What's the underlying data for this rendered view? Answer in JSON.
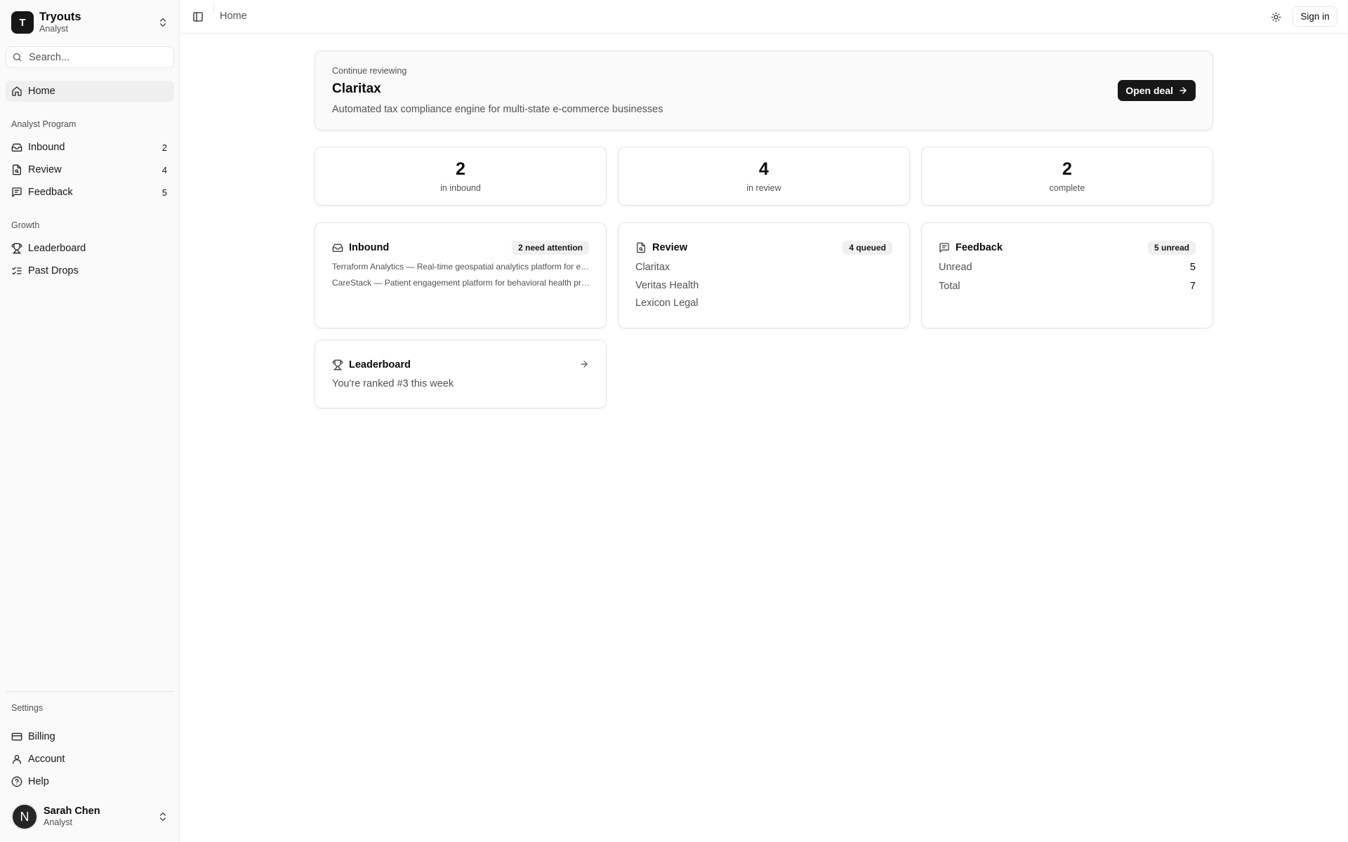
{
  "team": {
    "name": "Tryouts",
    "role": "Analyst",
    "initial": "T"
  },
  "search": {
    "placeholder": "Search..."
  },
  "sidebar": {
    "home": {
      "label": "Home"
    },
    "groups": {
      "program": "Analyst Program",
      "growth": "Growth",
      "settings": "Settings"
    },
    "program_items": [
      {
        "label": "Inbound",
        "count": "2",
        "icon": "inbox-icon"
      },
      {
        "label": "Review",
        "count": "4",
        "icon": "file-search-icon"
      },
      {
        "label": "Feedback",
        "count": "5",
        "icon": "message-square-icon"
      }
    ],
    "growth_items": [
      {
        "label": "Leaderboard",
        "icon": "trophy-icon"
      },
      {
        "label": "Past Drops",
        "icon": "list-checks-icon"
      }
    ],
    "settings_items": [
      {
        "label": "Billing",
        "icon": "credit-card-icon"
      },
      {
        "label": "Account",
        "icon": "user-icon"
      },
      {
        "label": "Help",
        "icon": "help-circle-icon"
      }
    ]
  },
  "user": {
    "name": "Sarah Chen",
    "role": "Analyst",
    "initial": "N"
  },
  "header": {
    "breadcrumb": "Home",
    "signin_label": "Sign in"
  },
  "hero": {
    "kicker": "Continue reviewing",
    "title": "Claritax",
    "description": "Automated tax compliance engine for multi-state e-commerce businesses",
    "button_label": "Open deal"
  },
  "stats": [
    {
      "value": "2",
      "label": "in inbound"
    },
    {
      "value": "4",
      "label": "in review"
    },
    {
      "value": "2",
      "label": "complete"
    }
  ],
  "inbound_card": {
    "title": "Inbound",
    "badge": "2 need attention",
    "items": [
      "Terraform Analytics — Real-time geospatial analytics platform for enterprise logistics",
      "CareStack — Patient engagement platform for behavioral health providers"
    ]
  },
  "review_card": {
    "title": "Review",
    "badge": "4 queued",
    "items": [
      "Claritax",
      "Veritas Health",
      "Lexicon Legal"
    ]
  },
  "feedback_card": {
    "title": "Feedback",
    "badge": "5 unread",
    "rows": [
      {
        "label": "Unread",
        "value": "5"
      },
      {
        "label": "Total",
        "value": "7"
      }
    ]
  },
  "leaderboard_card": {
    "title": "Leaderboard",
    "text": "You're ranked #3 this week"
  },
  "colors": {
    "accent": "#171717",
    "sidebar_bg": "#fafafa",
    "muted_text": "#525252"
  }
}
